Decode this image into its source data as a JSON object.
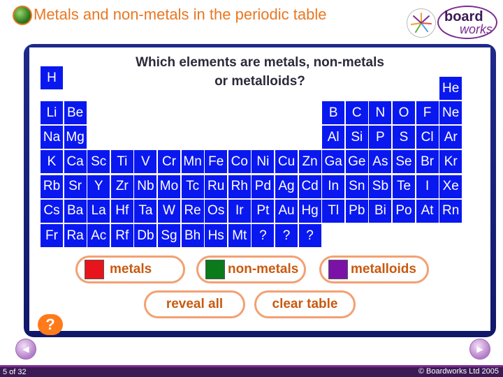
{
  "header": {
    "title": "Metals and non-metals in the periodic table"
  },
  "logo": {
    "line1": "board",
    "line2": "works"
  },
  "question": {
    "line1": "Which elements are metals, non-metals",
    "line2": "or metalloids?"
  },
  "elements": [
    {
      "sym": "H",
      "r": 0,
      "c": 0
    },
    {
      "sym": "He",
      "r": 1,
      "c": 17
    },
    {
      "sym": "Li",
      "r": 2,
      "c": 0
    },
    {
      "sym": "Be",
      "r": 2,
      "c": 1
    },
    {
      "sym": "B",
      "r": 2,
      "c": 12
    },
    {
      "sym": "C",
      "r": 2,
      "c": 13
    },
    {
      "sym": "N",
      "r": 2,
      "c": 14
    },
    {
      "sym": "O",
      "r": 2,
      "c": 15
    },
    {
      "sym": "F",
      "r": 2,
      "c": 16
    },
    {
      "sym": "Ne",
      "r": 2,
      "c": 17
    },
    {
      "sym": "Na",
      "r": 3,
      "c": 0
    },
    {
      "sym": "Mg",
      "r": 3,
      "c": 1
    },
    {
      "sym": "Al",
      "r": 3,
      "c": 12
    },
    {
      "sym": "Si",
      "r": 3,
      "c": 13
    },
    {
      "sym": "P",
      "r": 3,
      "c": 14
    },
    {
      "sym": "S",
      "r": 3,
      "c": 15
    },
    {
      "sym": "Cl",
      "r": 3,
      "c": 16
    },
    {
      "sym": "Ar",
      "r": 3,
      "c": 17
    },
    {
      "sym": "K",
      "r": 4,
      "c": 0
    },
    {
      "sym": "Ca",
      "r": 4,
      "c": 1
    },
    {
      "sym": "Sc",
      "r": 4,
      "c": 2
    },
    {
      "sym": "Ti",
      "r": 4,
      "c": 3
    },
    {
      "sym": "V",
      "r": 4,
      "c": 4
    },
    {
      "sym": "Cr",
      "r": 4,
      "c": 5
    },
    {
      "sym": "Mn",
      "r": 4,
      "c": 6
    },
    {
      "sym": "Fe",
      "r": 4,
      "c": 7
    },
    {
      "sym": "Co",
      "r": 4,
      "c": 8
    },
    {
      "sym": "Ni",
      "r": 4,
      "c": 9
    },
    {
      "sym": "Cu",
      "r": 4,
      "c": 10
    },
    {
      "sym": "Zn",
      "r": 4,
      "c": 11
    },
    {
      "sym": "Ga",
      "r": 4,
      "c": 12
    },
    {
      "sym": "Ge",
      "r": 4,
      "c": 13
    },
    {
      "sym": "As",
      "r": 4,
      "c": 14
    },
    {
      "sym": "Se",
      "r": 4,
      "c": 15
    },
    {
      "sym": "Br",
      "r": 4,
      "c": 16
    },
    {
      "sym": "Kr",
      "r": 4,
      "c": 17
    },
    {
      "sym": "Rb",
      "r": 5,
      "c": 0
    },
    {
      "sym": "Sr",
      "r": 5,
      "c": 1
    },
    {
      "sym": "Y",
      "r": 5,
      "c": 2
    },
    {
      "sym": "Zr",
      "r": 5,
      "c": 3
    },
    {
      "sym": "Nb",
      "r": 5,
      "c": 4
    },
    {
      "sym": "Mo",
      "r": 5,
      "c": 5
    },
    {
      "sym": "Tc",
      "r": 5,
      "c": 6
    },
    {
      "sym": "Ru",
      "r": 5,
      "c": 7
    },
    {
      "sym": "Rh",
      "r": 5,
      "c": 8
    },
    {
      "sym": "Pd",
      "r": 5,
      "c": 9
    },
    {
      "sym": "Ag",
      "r": 5,
      "c": 10
    },
    {
      "sym": "Cd",
      "r": 5,
      "c": 11
    },
    {
      "sym": "In",
      "r": 5,
      "c": 12
    },
    {
      "sym": "Sn",
      "r": 5,
      "c": 13
    },
    {
      "sym": "Sb",
      "r": 5,
      "c": 14
    },
    {
      "sym": "Te",
      "r": 5,
      "c": 15
    },
    {
      "sym": "I",
      "r": 5,
      "c": 16
    },
    {
      "sym": "Xe",
      "r": 5,
      "c": 17
    },
    {
      "sym": "Cs",
      "r": 6,
      "c": 0
    },
    {
      "sym": "Ba",
      "r": 6,
      "c": 1
    },
    {
      "sym": "La",
      "r": 6,
      "c": 2
    },
    {
      "sym": "Hf",
      "r": 6,
      "c": 3
    },
    {
      "sym": "Ta",
      "r": 6,
      "c": 4
    },
    {
      "sym": "W",
      "r": 6,
      "c": 5
    },
    {
      "sym": "Re",
      "r": 6,
      "c": 6
    },
    {
      "sym": "Os",
      "r": 6,
      "c": 7
    },
    {
      "sym": "Ir",
      "r": 6,
      "c": 8
    },
    {
      "sym": "Pt",
      "r": 6,
      "c": 9
    },
    {
      "sym": "Au",
      "r": 6,
      "c": 10
    },
    {
      "sym": "Hg",
      "r": 6,
      "c": 11
    },
    {
      "sym": "Tl",
      "r": 6,
      "c": 12
    },
    {
      "sym": "Pb",
      "r": 6,
      "c": 13
    },
    {
      "sym": "Bi",
      "r": 6,
      "c": 14
    },
    {
      "sym": "Po",
      "r": 6,
      "c": 15
    },
    {
      "sym": "At",
      "r": 6,
      "c": 16
    },
    {
      "sym": "Rn",
      "r": 6,
      "c": 17
    },
    {
      "sym": "Fr",
      "r": 7,
      "c": 0
    },
    {
      "sym": "Ra",
      "r": 7,
      "c": 1
    },
    {
      "sym": "Ac",
      "r": 7,
      "c": 2
    },
    {
      "sym": "Rf",
      "r": 7,
      "c": 3
    },
    {
      "sym": "Db",
      "r": 7,
      "c": 4
    },
    {
      "sym": "Sg",
      "r": 7,
      "c": 5
    },
    {
      "sym": "Bh",
      "r": 7,
      "c": 6
    },
    {
      "sym": "Hs",
      "r": 7,
      "c": 7
    },
    {
      "sym": "Mt",
      "r": 7,
      "c": 8
    },
    {
      "sym": "?",
      "r": 7,
      "c": 9
    },
    {
      "sym": "?",
      "r": 7,
      "c": 10
    },
    {
      "sym": "?",
      "r": 7,
      "c": 11
    }
  ],
  "legend": {
    "metals": {
      "label": "metals",
      "color": "#e8141b"
    },
    "non_metals": {
      "label": "non-metals",
      "color": "#0a7a1a"
    },
    "metalloids": {
      "label": "metalloids",
      "color": "#7b12a8"
    }
  },
  "actions": {
    "reveal_all": "reveal all",
    "clear_table": "clear table",
    "help": "?"
  },
  "footer": {
    "page": "5 of 32",
    "copyright": "© Boardworks Ltd 2005"
  },
  "colors": {
    "cell": "#0a18f0",
    "accent": "#e87722",
    "board": "#1d2a8a"
  }
}
